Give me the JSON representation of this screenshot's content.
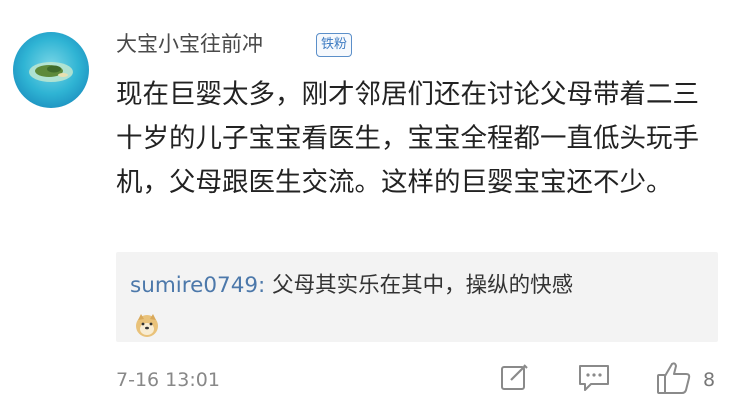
{
  "comment": {
    "username": "大宝小宝往前冲",
    "badge": "铁粉",
    "content": "现在巨婴太多，刚才邻居们还在讨论父母带着二三十岁的儿子宝宝看医生，宝宝全程都一直低头玩手机，父母跟医生交流。这样的巨婴宝宝还不少。"
  },
  "reply": {
    "user": "sumire0749:",
    "text": " 父母其实乐在其中，操纵的快感",
    "emoji": "doge-emoji"
  },
  "footer": {
    "timestamp": "7-16 13:01",
    "like_count": "8"
  },
  "icons": {
    "avatar": "island-avatar",
    "edit": "edit-icon",
    "comment": "comment-icon",
    "like": "thumbs-up-icon"
  },
  "colors": {
    "username": "#4a4a4a",
    "badge": "#3f7cc2",
    "reply_user": "#4c78aa",
    "reply_bg": "#f3f3f3"
  }
}
